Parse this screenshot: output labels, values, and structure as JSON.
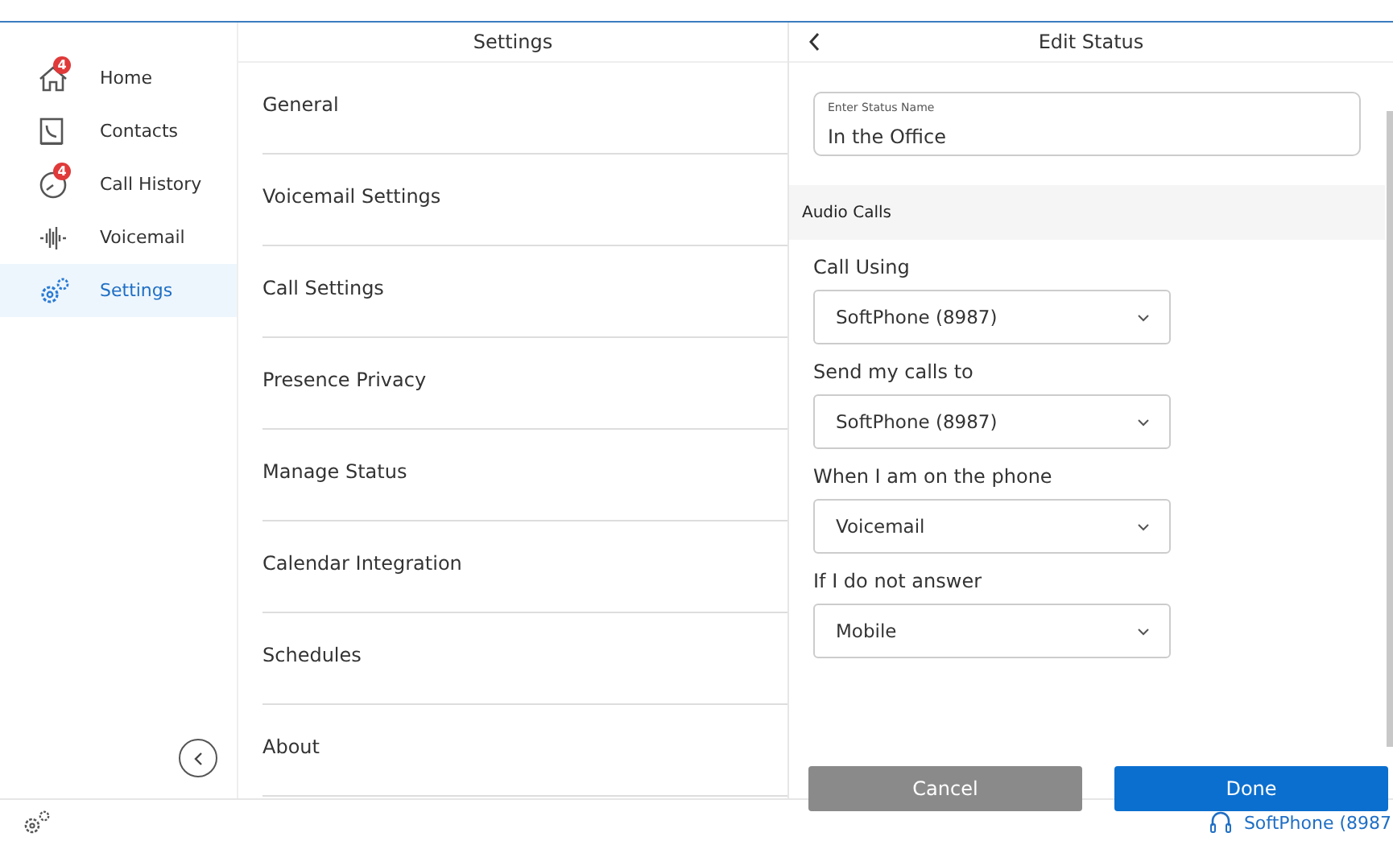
{
  "sidebar": {
    "items": [
      {
        "label": "Home",
        "badge": "4",
        "selected": false
      },
      {
        "label": "Contacts",
        "selected": false
      },
      {
        "label": "Call History",
        "badge": "4",
        "selected": false
      },
      {
        "label": "Voicemail",
        "selected": false
      },
      {
        "label": "Settings",
        "selected": true
      }
    ]
  },
  "settings": {
    "title": "Settings",
    "items": [
      "General",
      "Voicemail Settings",
      "Call Settings",
      "Presence Privacy",
      "Manage Status",
      "Calendar Integration",
      "Schedules",
      "About"
    ]
  },
  "edit_status": {
    "title": "Edit Status",
    "name_field": {
      "label": "Enter Status Name",
      "value": "In the Office"
    },
    "section": "Audio Calls",
    "dropdowns": [
      {
        "label": "Call Using",
        "value": "SoftPhone (8987)"
      },
      {
        "label": "Send my calls to",
        "value": "SoftPhone (8987)"
      },
      {
        "label": "When I am on the phone",
        "value": "Voicemail"
      },
      {
        "label": "If I do not answer",
        "value": "Mobile"
      }
    ],
    "buttons": [
      {
        "label": "Cancel",
        "kind": "secondary"
      },
      {
        "label": "Done",
        "kind": "primary"
      }
    ]
  },
  "status_bar": {
    "device": "SoftPhone (8987"
  }
}
